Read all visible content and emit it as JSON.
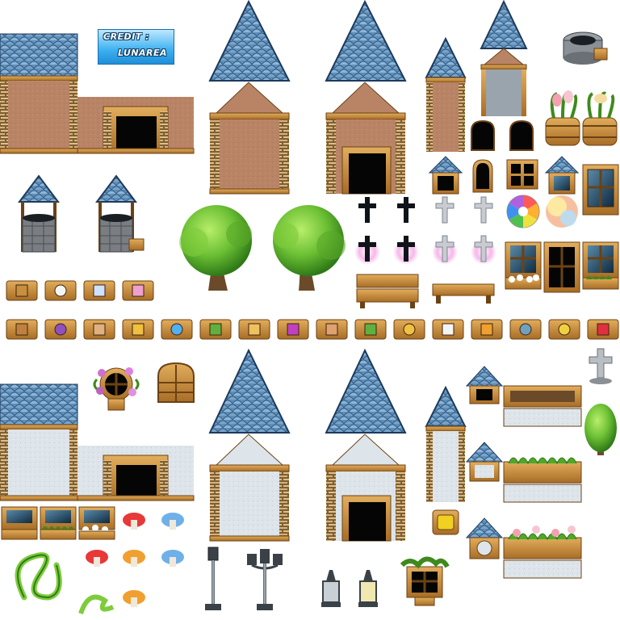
{
  "credit": {
    "line1": "CREDIT :",
    "line2": "LUNAREA"
  },
  "tileset": {
    "background": "#ffffff"
  },
  "palette": {
    "roof_light": "#8fb6d6",
    "roof_mid": "#5f8fb8",
    "roof_dark": "#2f5a86",
    "roof_edge": "#1d3a5c",
    "wall_tan": "#b98466",
    "wall_white": "#dde4ea",
    "wood": "#c88f3e",
    "wood_dark": "#6b4214",
    "stone": "#bfa37a",
    "stone_dark": "#7d5f34",
    "door": "#050505",
    "leaf_light": "#8fd64a",
    "leaf_dark": "#2f7a18",
    "trunk": "#6b4a2a",
    "metal": "#7d8890",
    "metal_dark": "#3a4248",
    "credit_blue": "#3cb0f0"
  }
}
